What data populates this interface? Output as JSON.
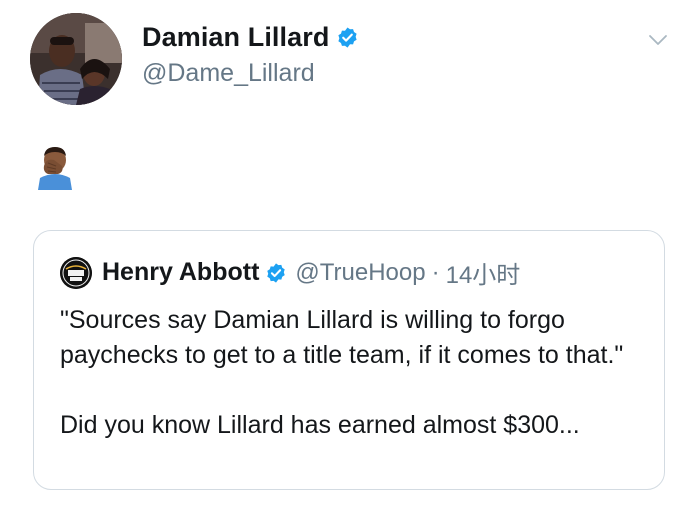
{
  "tweet": {
    "author": {
      "display_name": "Damian Lillard",
      "handle": "@Dame_Lillard",
      "verified": true
    },
    "body_emoji": "🤦🏾‍♂️",
    "quoted": {
      "author": {
        "display_name": "Henry Abbott",
        "handle": "@TrueHoop",
        "verified": true,
        "avatar_text": "TRUE HOOP"
      },
      "separator": "·",
      "time": "14小时",
      "paragraphs": [
        "\"Sources say Damian Lillard is willing to forgo paychecks to get to a title team, if it comes to that.\"",
        "Did you know Lillard has earned almost $300..."
      ]
    }
  },
  "colors": {
    "text_primary": "#14171a",
    "text_secondary": "#657786",
    "verified_blue": "#1da1f2",
    "border": "#d3dbe2"
  },
  "icons": {
    "verified": "verified-badge-icon",
    "menu": "chevron-down-icon"
  }
}
